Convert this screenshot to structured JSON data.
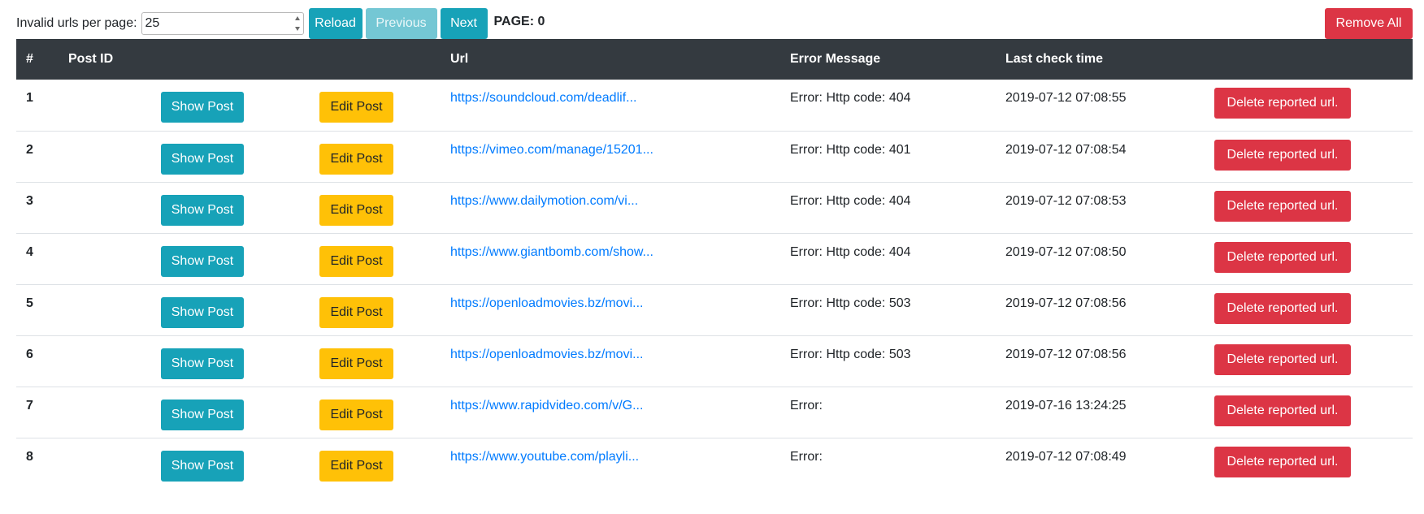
{
  "toolbar": {
    "per_page_label": "Invalid urls per page:",
    "per_page_value": "25",
    "reload_label": "Reload",
    "previous_label": "Previous",
    "next_label": "Next",
    "page_label": "PAGE: 0",
    "remove_all_label": "Remove All"
  },
  "table": {
    "headers": [
      "#",
      "Post ID",
      "",
      "",
      "Url",
      "Error Message",
      "Last check time",
      ""
    ],
    "show_label": "Show Post",
    "edit_label": "Edit Post",
    "delete_label": "Delete reported url.",
    "rows": [
      {
        "num": "1",
        "url": "https://soundcloud.com/deadlif...",
        "error": "Error: Http code: 404",
        "time": "2019-07-12 07:08:55"
      },
      {
        "num": "2",
        "url": "https://vimeo.com/manage/15201...",
        "error": "Error: Http code: 401",
        "time": "2019-07-12 07:08:54"
      },
      {
        "num": "3",
        "url": "https://www.dailymotion.com/vi...",
        "error": "Error: Http code: 404",
        "time": "2019-07-12 07:08:53"
      },
      {
        "num": "4",
        "url": "https://www.giantbomb.com/show...",
        "error": "Error: Http code: 404",
        "time": "2019-07-12 07:08:50"
      },
      {
        "num": "5",
        "url": "https://openloadmovies.bz/movi...",
        "error": "Error: Http code: 503",
        "time": "2019-07-12 07:08:56"
      },
      {
        "num": "6",
        "url": "https://openloadmovies.bz/movi...",
        "error": "Error: Http code: 503",
        "time": "2019-07-12 07:08:56"
      },
      {
        "num": "7",
        "url": "https://www.rapidvideo.com/v/G...",
        "error": "Error:",
        "time": "2019-07-16 13:24:25"
      },
      {
        "num": "8",
        "url": "https://www.youtube.com/playli...",
        "error": "Error:",
        "time": "2019-07-12 07:08:49"
      }
    ]
  }
}
